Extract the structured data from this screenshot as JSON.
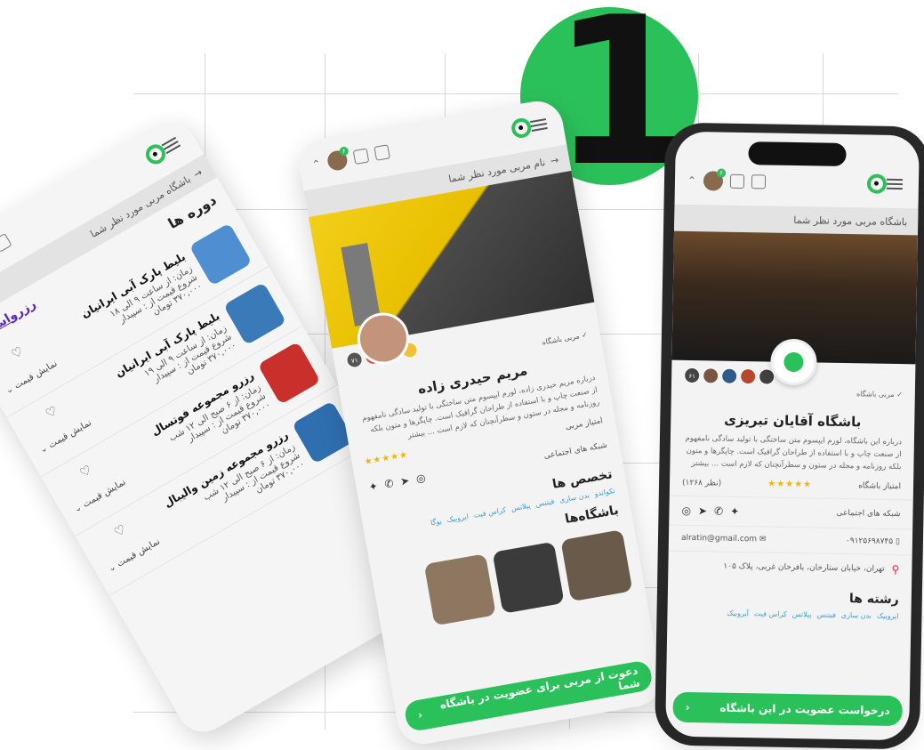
{
  "badge": {
    "number": "1"
  },
  "phone_left": {
    "back_title": "باشگاه مربی مورد نظر شما",
    "notification_count": "۶",
    "courses_heading": "دوره ها",
    "reserve_label": "رزرواسیون",
    "courses": [
      {
        "name": "بلیط پارک آبی ایرانیان",
        "time": "زمان: از ساعت ۹ الی ۱۸",
        "start": "شروع قیمت از : سپیدار",
        "price": "۳۷۰,۰۰۰ تومان",
        "show_price": "نمایش قیمت",
        "thumb_color": "#4f8fd1"
      },
      {
        "name": "بلیط پارک آبی ایرانیان",
        "time": "زمان: از ساعت ۹ الی ۱۹",
        "start": "شروع قیمت از : سپیدار",
        "price": "۳۷۰,۰۰۰ تومان",
        "show_price": "نمایش قیمت",
        "thumb_color": "#3a7ab8"
      },
      {
        "name": "رزرو مجموعه فوتسال",
        "time": "زمان: از ۶ صبح الی ۱۲ شب",
        "start": "شروع قیمت از : سپیدار",
        "price": "۳۷۰,۰۰۰ تومان",
        "show_price": "نمایش قیمت",
        "thumb_color": "#c9302c"
      },
      {
        "name": "رزرو مجموعه زمین والیبال",
        "time": "زمان: از ۶ صبح الی ۱۲ شب",
        "start": "شروع قیمت از : سپیدار",
        "price": "۳۷۰,۰۰۰ تومان",
        "show_price": "نمایش قیمت",
        "thumb_color": "#2f6fb0"
      }
    ]
  },
  "phone_mid": {
    "back_title": "نام مربی مورد نظر شما",
    "notification_count": "۶",
    "member_count": "۷۱",
    "coach_club_tag": "مربی باشگاه",
    "name": "مریم حیدری زاده",
    "description": "درباره مریم حیدری زاده، لورم ایپسوم متن ساختگی با تولید سادگی نامفهوم از صنعت چاپ و با استفاده از طراحان گرافیک است. چاپگرها و متون بلکه روزنامه و مجله در ستون و سطرآنچنان که لازم است ... بیشتر",
    "rating_label": "امتیاز مربی",
    "stars": "★★★★★",
    "social_label": "شبکه های اجتماعی",
    "specialties_title": "تخصص ها",
    "tags": [
      "تکواندو",
      "بدن سازی",
      "فیتنس",
      "پیلاتس",
      "کراس فیت",
      "ایروبیک",
      "یوگا"
    ],
    "clubs_title": "باشگاه‌ها",
    "cta": "دعوت از مربی برای عضویت در باشگاه شما"
  },
  "phone_right": {
    "back_title": "باشگاه مربی مورد نظر شما",
    "notification_count": "۶",
    "member_count": "۶۱",
    "coach_tag": "مربی باشگاه",
    "name": "باشگاه آقایان تبریزی",
    "description": "درباره این باشگاه، لورم ایپسوم متن ساختگی با تولید سادگی نامفهوم از صنعت چاپ و با استفاده از طراحان گرافیک است. چاپگرها و متون بلکه روزنامه و مجله در ستون و سطرآنچنان که لازم است ... بیشتر",
    "rating_label": "امتیاز باشگاه",
    "stars": "★★★★★",
    "votes": "(نظر ۱۲۶۸)",
    "social_label": "شبکه های اجتماعی",
    "email": "alratin@gmail.com",
    "phone": "۰۹۱۲۵۶۹۸۷۴۵",
    "address": "تهران، خیابان ستارخان، بافرخان غربی، پلاک ۱۰۵",
    "fields_title": "رشته ها",
    "tags": [
      "ایروبیک",
      "بدن سازی",
      "فیتنس",
      "پیلاتس",
      "کراس فیت",
      "آیروبیک"
    ],
    "cta": "درخواست عضویت در این باشگاه"
  }
}
